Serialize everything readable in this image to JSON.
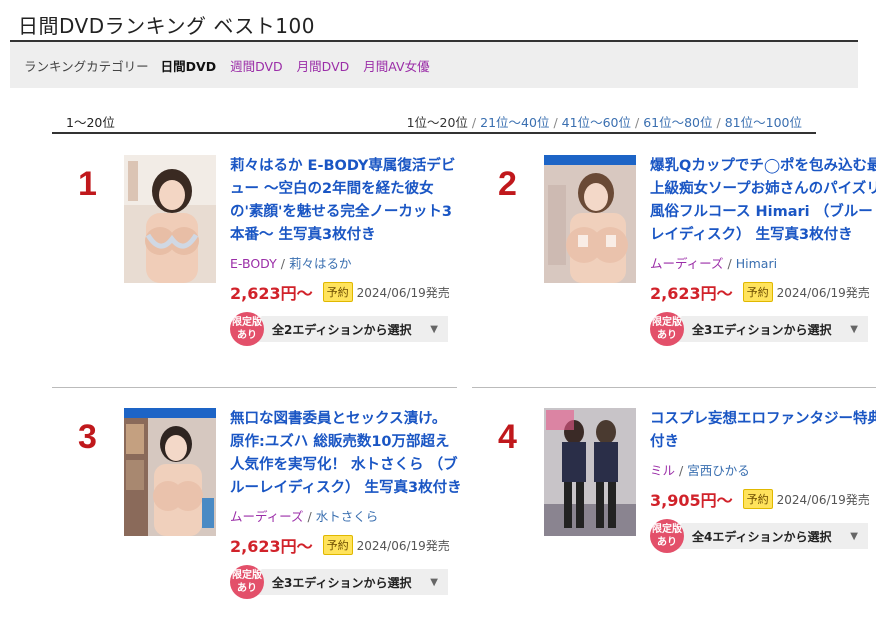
{
  "page": {
    "title": "日間DVDランキング ベスト100"
  },
  "categories": {
    "label": "ランキングカテゴリー",
    "items": [
      {
        "label": "日間DVD",
        "active": true
      },
      {
        "label": "週間DVD",
        "active": false
      },
      {
        "label": "月間DVD",
        "active": false
      },
      {
        "label": "月間AV女優",
        "active": false
      }
    ]
  },
  "range": {
    "current": "1〜20位",
    "pages": [
      "1位〜20位",
      "21位〜40位",
      "41位〜60位",
      "61位〜80位",
      "81位〜100位"
    ]
  },
  "edition_arrow": "▼",
  "limited_label": [
    "限定版",
    "あり"
  ],
  "items": [
    {
      "rank": "1",
      "title": "莉々はるか E-BODY専属復活デビュー 〜空白の2年間を経た彼女の'素顔'を魅せる完全ノーカット3本番〜 生写真3枚付き",
      "maker": "E-BODY",
      "actress": "莉々はるか",
      "price": "2,623円〜",
      "badge": "予約",
      "release": "2024/06/19発売",
      "editions": "全2エディションから選択"
    },
    {
      "rank": "2",
      "title": "爆乳Qカップでチ◯ポを包み込む最上級痴女ソープお姉さんのパイズリ風俗フルコース Himari （ブルーレイディスク） 生写真3枚付き",
      "maker": "ムーディーズ",
      "actress": "Himari",
      "price": "2,623円〜",
      "badge": "予約",
      "release": "2024/06/19発売",
      "editions": "全3エディションから選択"
    },
    {
      "rank": "3",
      "title": "無口な図書委員とセックス漬け。 原作:ユズハ 総販売数10万部超え人気作を実写化！ 水トさくら （ブルーレイディスク） 生写真3枚付き",
      "maker": "ムーディーズ",
      "actress": "水トさくら",
      "price": "2,623円〜",
      "badge": "予約",
      "release": "2024/06/19発売",
      "editions": "全3エディションから選択"
    },
    {
      "rank": "4",
      "title": "コスプレ妄想エロファンタジー特典付き",
      "maker": "ミル",
      "actress": "宮西ひかる",
      "price": "3,905円〜",
      "badge": "予約",
      "release": "2024/06/19発売",
      "editions": "全4エディションから選択"
    }
  ]
}
